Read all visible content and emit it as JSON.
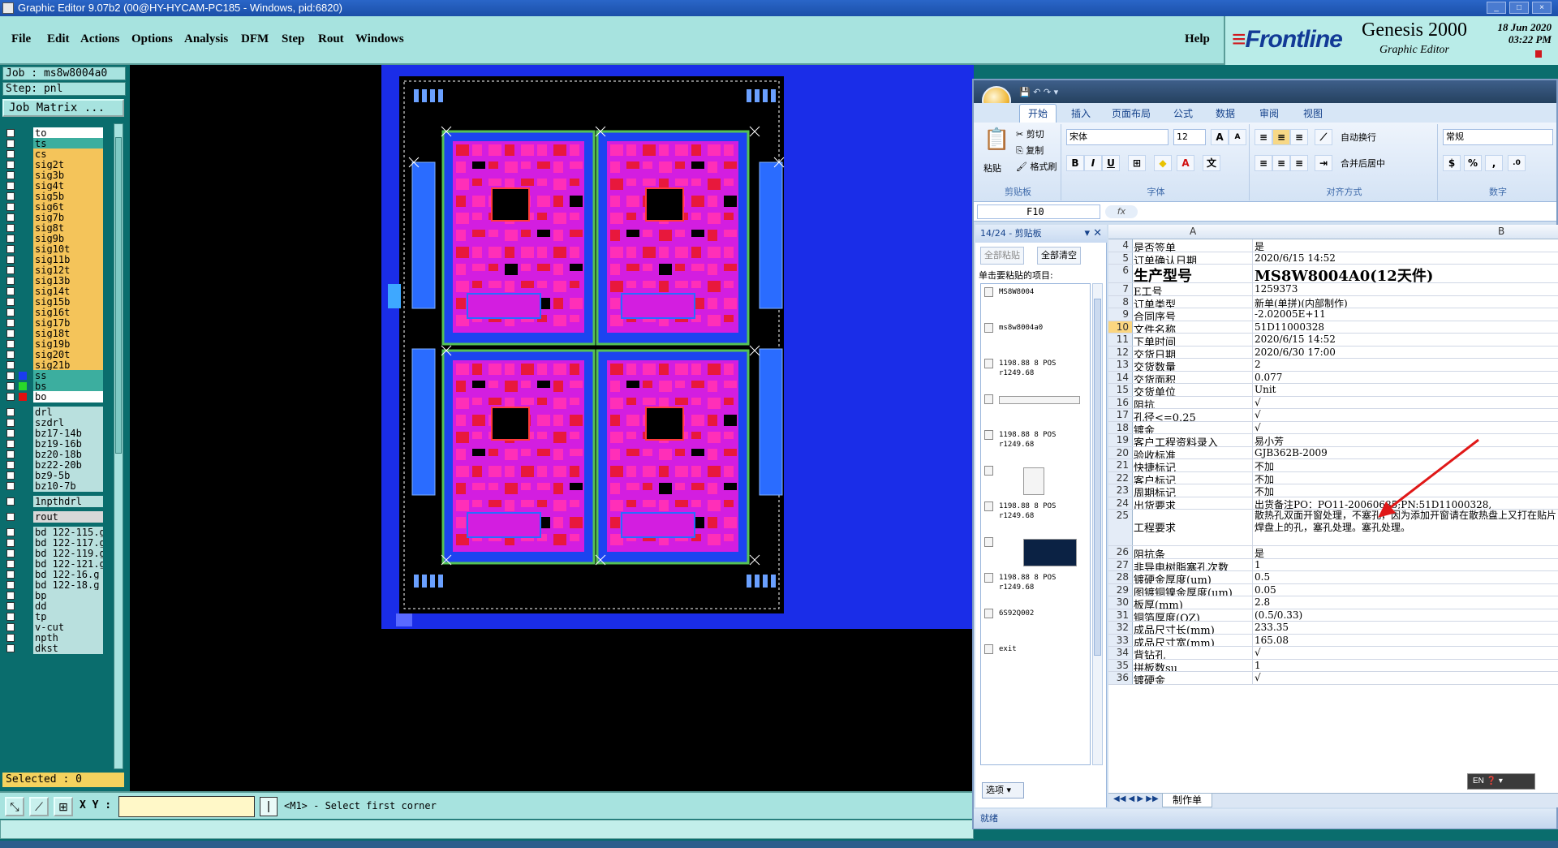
{
  "window": {
    "title": "Graphic Editor 9.07b2 (00@HY-HYCAM-PC185 - Windows, pid:6820)"
  },
  "menubar": {
    "items": [
      "File",
      "Edit",
      "Actions",
      "Options",
      "Analysis",
      "DFM",
      "Step",
      "Rout",
      "Windows"
    ],
    "help": "Help"
  },
  "brand": {
    "logo": "Frontline",
    "product": "Genesis 2000",
    "subtitle": "Graphic Editor",
    "date_line1": "18 Jun 2020",
    "date_line2": "03:22 PM"
  },
  "job": {
    "job_label": "Job : ms8w8004a0",
    "step_label": "Step: pnl",
    "matrix_button": "Job Matrix ..."
  },
  "layers": [
    {
      "name": "to",
      "color": "#ffffff",
      "swatch": ""
    },
    {
      "name": "ts",
      "color": "#3cae9f",
      "swatch": ""
    },
    {
      "name": "cs",
      "color": "#f4c45a",
      "swatch": ""
    },
    {
      "name": "sig2t",
      "color": "#f4c45a",
      "swatch": ""
    },
    {
      "name": "sig3b",
      "color": "#f4c45a",
      "swatch": ""
    },
    {
      "name": "sig4t",
      "color": "#f4c45a",
      "swatch": ""
    },
    {
      "name": "sig5b",
      "color": "#f4c45a",
      "swatch": ""
    },
    {
      "name": "sig6t",
      "color": "#f4c45a",
      "swatch": ""
    },
    {
      "name": "sig7b",
      "color": "#f4c45a",
      "swatch": ""
    },
    {
      "name": "sig8t",
      "color": "#f4c45a",
      "swatch": ""
    },
    {
      "name": "sig9b",
      "color": "#f4c45a",
      "swatch": ""
    },
    {
      "name": "sig10t",
      "color": "#f4c45a",
      "swatch": ""
    },
    {
      "name": "sig11b",
      "color": "#f4c45a",
      "swatch": ""
    },
    {
      "name": "sig12t",
      "color": "#f4c45a",
      "swatch": ""
    },
    {
      "name": "sig13b",
      "color": "#f4c45a",
      "swatch": ""
    },
    {
      "name": "sig14t",
      "color": "#f4c45a",
      "swatch": ""
    },
    {
      "name": "sig15b",
      "color": "#f4c45a",
      "swatch": ""
    },
    {
      "name": "sig16t",
      "color": "#f4c45a",
      "swatch": ""
    },
    {
      "name": "sig17b",
      "color": "#f4c45a",
      "swatch": ""
    },
    {
      "name": "sig18t",
      "color": "#f4c45a",
      "swatch": ""
    },
    {
      "name": "sig19b",
      "color": "#f4c45a",
      "swatch": ""
    },
    {
      "name": "sig20t",
      "color": "#f4c45a",
      "swatch": ""
    },
    {
      "name": "sig21b",
      "color": "#f4c45a",
      "swatch": ""
    },
    {
      "name": "ss",
      "color": "#3cae9f",
      "swatch": "#1a3cf0"
    },
    {
      "name": "bs",
      "color": "#3cae9f",
      "swatch": "#2ad82a"
    },
    {
      "name": "bo",
      "color": "#ffffff",
      "swatch": "#e01010"
    },
    {
      "name": "drl",
      "color": "#b9e0de",
      "swatch": ""
    },
    {
      "name": "szdrl",
      "color": "#b9e0de",
      "swatch": ""
    },
    {
      "name": "bz17-14b",
      "color": "#b9e0de",
      "swatch": ""
    },
    {
      "name": "bz19-16b",
      "color": "#b9e0de",
      "swatch": ""
    },
    {
      "name": "bz20-18b",
      "color": "#b9e0de",
      "swatch": ""
    },
    {
      "name": "bz22-20b",
      "color": "#b9e0de",
      "swatch": ""
    },
    {
      "name": "bz9-5b",
      "color": "#b9e0de",
      "swatch": ""
    },
    {
      "name": "bz10-7b",
      "color": "#b9e0de",
      "swatch": ""
    },
    {
      "name": "1npthdrl",
      "color": "#b9e0de",
      "swatch": ""
    },
    {
      "name": "rout",
      "color": "#d8d8d8",
      "swatch": ""
    },
    {
      "name": "bd_122-115.g",
      "color": "#b9e0de",
      "swatch": ""
    },
    {
      "name": "bd_122-117.g",
      "color": "#b9e0de",
      "swatch": ""
    },
    {
      "name": "bd_122-119.g",
      "color": "#b9e0de",
      "swatch": ""
    },
    {
      "name": "bd_122-121.g",
      "color": "#b9e0de",
      "swatch": ""
    },
    {
      "name": "bd_122-16.g",
      "color": "#b9e0de",
      "swatch": ""
    },
    {
      "name": "bd_122-18.g",
      "color": "#b9e0de",
      "swatch": ""
    },
    {
      "name": "bp",
      "color": "#b9e0de",
      "swatch": ""
    },
    {
      "name": "dd",
      "color": "#b9e0de",
      "swatch": ""
    },
    {
      "name": "tp",
      "color": "#b9e0de",
      "swatch": ""
    },
    {
      "name": "v-cut",
      "color": "#b9e0de",
      "swatch": ""
    },
    {
      "name": "npth",
      "color": "#b9e0de",
      "swatch": ""
    },
    {
      "name": "dkst",
      "color": "#b9e0de",
      "swatch": ""
    }
  ],
  "selected_label": "Selected : 0",
  "bottom": {
    "xy_label": "X Y :",
    "pipe": "|",
    "prompt": "<M1> - Select first corner"
  },
  "excel": {
    "tabs": [
      "开始",
      "插入",
      "页面布局",
      "公式",
      "数据",
      "审阅",
      "视图"
    ],
    "clipboard_group": "剪贴板",
    "paste": "粘贴",
    "cut": "剪切",
    "copy": "复制",
    "format_painter": "格式刷",
    "font_name": "宋体",
    "font_size": "12",
    "font_group": "字体",
    "wrap": "自动换行",
    "merge": "合并后居中",
    "align_group": "对齐方式",
    "number_format": "常规",
    "number_group": "数字",
    "name_box": "F10",
    "fx": "fx",
    "clip_header": "14/24 - 剪贴板",
    "paste_all": "全部粘贴",
    "clear_all": "全部清空",
    "clip_instruction": "单击要粘贴的项目:",
    "clip_items": [
      {
        "text": "MS8W8004"
      },
      {
        "text": "ms8w8004a0"
      },
      {
        "text": "1198.88 8 POS r1249.68"
      },
      {
        "text": ""
      },
      {
        "text": "1198.88 8 POS r1249.68"
      },
      {
        "text": ""
      },
      {
        "text": "1198.88 8 POS r1249.68"
      },
      {
        "text": ""
      },
      {
        "text": "1198.88 8 POS r1249.68"
      },
      {
        "text": "6S92Q002"
      },
      {
        "text": "exit"
      }
    ],
    "options": "选项 ▾",
    "col_a": "A",
    "col_b": "B",
    "rows": [
      {
        "n": "4",
        "a": "是否签单",
        "b": "是"
      },
      {
        "n": "5",
        "a": "订单确认日期",
        "b": "2020/6/15 14:52"
      },
      {
        "n": "6",
        "a": "生产型号",
        "b": "MS8W8004A0(12天件)",
        "big": true
      },
      {
        "n": "7",
        "a": "E工号",
        "b": "1259373"
      },
      {
        "n": "8",
        "a": "订单类型",
        "b": "新单(单拼)(内部制作)"
      },
      {
        "n": "9",
        "a": "合同序号",
        "b": "-2.02005E+11"
      },
      {
        "n": "10",
        "a": "文件名称",
        "b": "51D11000328"
      },
      {
        "n": "11",
        "a": "下单时间",
        "b": "2020/6/15 14:52"
      },
      {
        "n": "12",
        "a": "交货日期",
        "b": "2020/6/30 17:00"
      },
      {
        "n": "13",
        "a": "交货数量",
        "b": "2"
      },
      {
        "n": "14",
        "a": "交货面积",
        "b": "0.077"
      },
      {
        "n": "15",
        "a": "交货单位",
        "b": "Unit"
      },
      {
        "n": "16",
        "a": "阻抗",
        "b": "√"
      },
      {
        "n": "17",
        "a": "孔径<=0.25",
        "b": "√"
      },
      {
        "n": "18",
        "a": "镀金",
        "b": "√"
      },
      {
        "n": "19",
        "a": "客户工程资料录入",
        "b": "易小芳"
      },
      {
        "n": "20",
        "a": "验收标准",
        "b": "GJB362B-2009"
      },
      {
        "n": "21",
        "a": "快捷标记",
        "b": "不加"
      },
      {
        "n": "22",
        "a": "客户标记",
        "b": "不加"
      },
      {
        "n": "23",
        "a": "周期标记",
        "b": "不加"
      },
      {
        "n": "24",
        "a": "出货要求",
        "b": "出货备注PO：PO11-20060685;PN:51D11000328,"
      },
      {
        "n": "25",
        "a": "工程要求",
        "b": "散热孔双面开窗处理，不塞孔，因为添加开窗请在散热盘上又打在贴片焊盘上的孔，塞孔处理。塞孔处理。",
        "multi": true
      },
      {
        "n": "26",
        "a": "阻抗条",
        "b": "是"
      },
      {
        "n": "27",
        "a": "非导电树脂塞孔次数",
        "b": "1"
      },
      {
        "n": "28",
        "a": "镀硬金厚度(um)",
        "b": "0.5"
      },
      {
        "n": "29",
        "a": "图镀铜镍金厚度(um)",
        "b": "0.05"
      },
      {
        "n": "30",
        "a": "板厚(mm)",
        "b": "2.8"
      },
      {
        "n": "31",
        "a": "铜箔厚度(OZ)",
        "b": "(0.5/0.33)"
      },
      {
        "n": "32",
        "a": "成品尺寸长(mm)",
        "b": "233.35"
      },
      {
        "n": "33",
        "a": "成品尺寸宽(mm)",
        "b": "165.08"
      },
      {
        "n": "34",
        "a": "背钻孔",
        "b": "√"
      },
      {
        "n": "35",
        "a": "拼板数su",
        "b": "1"
      },
      {
        "n": "36",
        "a": "镀硬金",
        "b": "√"
      }
    ],
    "sheet_tab": "制作单",
    "status": "就绪",
    "lang": "EN"
  },
  "colors": {
    "panel_bg": "#0a6d6d",
    "menubar_bg": "#a7e3df",
    "pcb_frame": "#1a2de8",
    "trace_red": "#e8183c",
    "trace_magenta": "#d31ee0",
    "arrow": "#e01818"
  }
}
